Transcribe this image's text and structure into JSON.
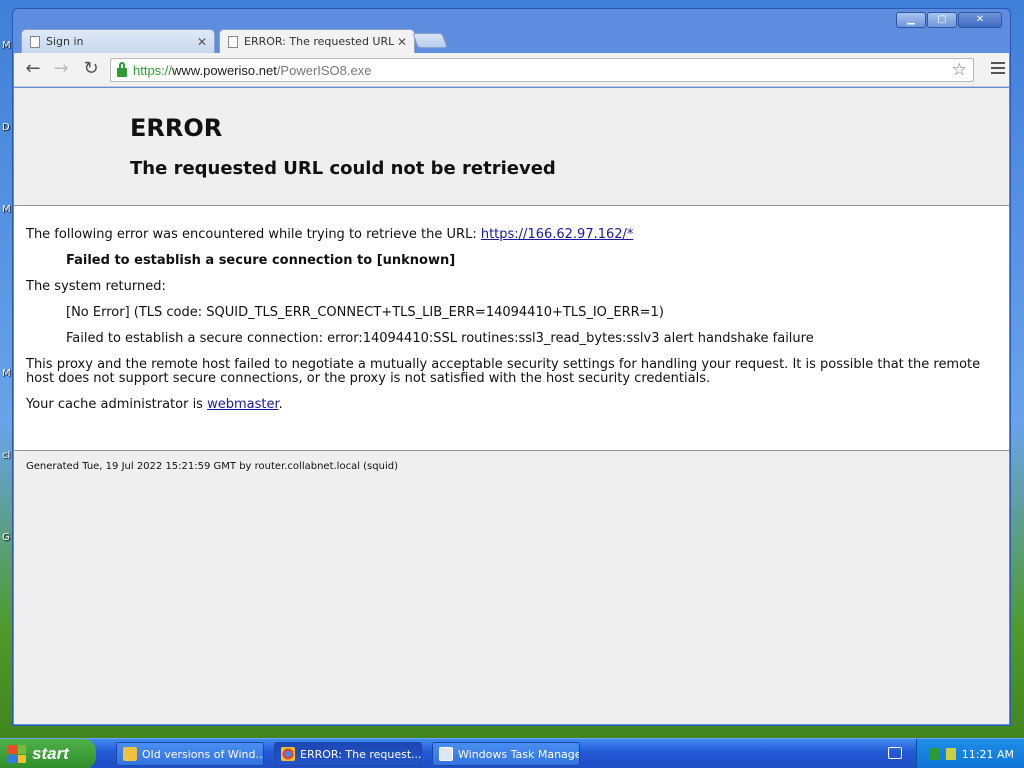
{
  "desktop": {
    "edge_letters": [
      "M",
      "D",
      "M",
      "M",
      "cl",
      "G"
    ]
  },
  "browser": {
    "tabs": [
      {
        "label": "Sign in",
        "active": false
      },
      {
        "label": "ERROR: The requested URL",
        "active": true
      }
    ],
    "url": {
      "scheme": "https://",
      "host": "www.poweriso.net",
      "path": "/PowerISO8.exe"
    }
  },
  "page": {
    "title": "ERROR",
    "subtitle": "The requested URL could not be retrieved",
    "line1_prefix": "The following error was encountered while trying to retrieve the URL: ",
    "line1_link": "https://166.62.97.162/*",
    "failed_msg": "Failed to establish a secure connection to [unknown]",
    "system_returned": "The system returned:",
    "error_code": "[No Error] (TLS code: SQUID_TLS_ERR_CONNECT+TLS_LIB_ERR=14094410+TLS_IO_ERR=1)",
    "error_detail": "Failed to establish a secure connection: error:14094410:SSL routines:ssl3_read_bytes:sslv3 alert handshake failure",
    "explanation": "This proxy and the remote host failed to negotiate a mutually acceptable security settings for handling your request. It is possible that the remote host does not support secure connections, or the proxy is not satisfied with the host security credentials.",
    "admin_prefix": "Your cache administrator is ",
    "admin_link": "webmaster",
    "admin_suffix": ".",
    "footer": "Generated Tue, 19 Jul 2022 15:21:59 GMT by router.collabnet.local (squid)"
  },
  "taskbar": {
    "start_label": "start",
    "items": [
      {
        "label": "Old versions of Wind...",
        "active": false
      },
      {
        "label": "ERROR: The request...",
        "active": true
      },
      {
        "label": "Windows Task Manager",
        "active": false
      }
    ],
    "clock": "11:21 AM"
  },
  "colors": {
    "secure_green": "#2e9a35",
    "link": "#1a1a9e",
    "xp_blue": "#2458d6",
    "start_green": "#3aa035"
  }
}
